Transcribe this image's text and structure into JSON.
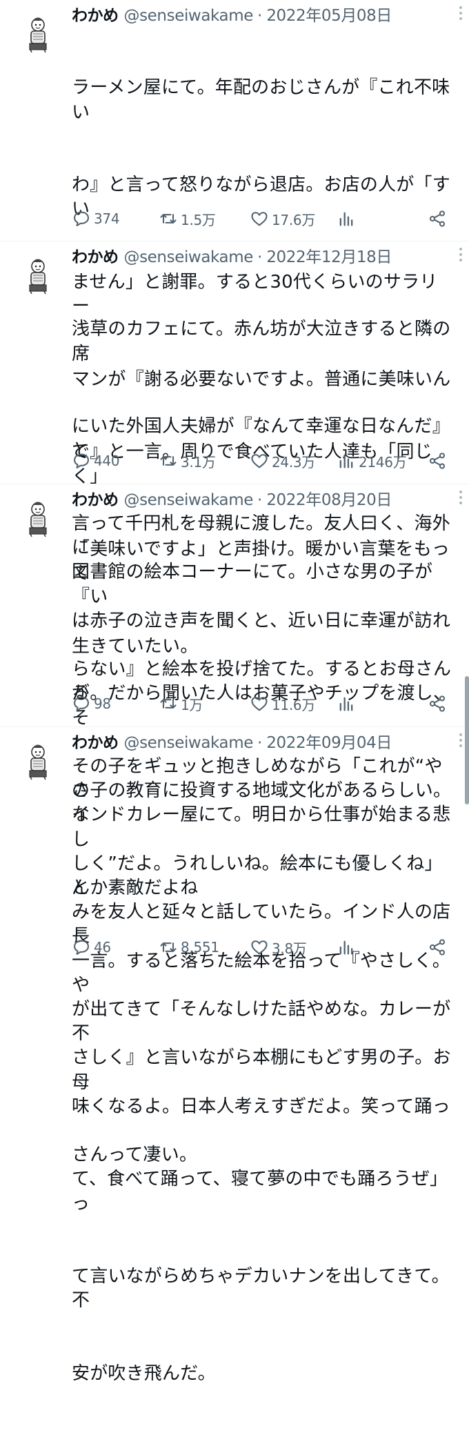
{
  "accent": "#536471",
  "tweets": [
    {
      "name": "わかめ",
      "handle": "@senseiwakame",
      "separator": "·",
      "date": "2022年05月08日",
      "text_lines": [
        "ラーメン屋にて。年配のおじさんが『これ不味い",
        "わ』と言って怒りながら退店。お店の人が「すい",
        "ません」と謝罪。すると30代くらいのサラリー",
        "マンが『謝る必要ないですよ。普通に美味いん",
        "で』と一言。周りで食べていた人達も「同じく」",
        "「美味いですよ」と声掛け。暖かい言葉をもって",
        "生きていたい。"
      ],
      "replies": "374",
      "retweets": "1.5万",
      "likes": "17.6万",
      "views": ""
    },
    {
      "name": "わかめ",
      "handle": "@senseiwakame",
      "separator": "·",
      "date": "2022年12月18日",
      "text_lines": [
        "浅草のカフェにて。赤ん坊が大泣きすると隣の席",
        "にいた外国人夫婦が『なんて幸運な日なんだ』と",
        "言って千円札を母親に渡した。友人曰く、海外に",
        "は赤子の泣き声を聞くと、近い日に幸運が訪れ",
        "る。だから聞いた人はお菓子やチップを渡し、そ",
        "の子の教育に投資する地域文化があるらしい。な",
        "んか素敵だよね"
      ],
      "replies": "440",
      "retweets": "3.1万",
      "likes": "24.3万",
      "views": "2146万"
    },
    {
      "name": "わかめ",
      "handle": "@senseiwakame",
      "separator": "·",
      "date": "2022年08月20日",
      "text_lines": [
        "図書館の絵本コーナーにて。小さな男の子が『い",
        "らない』と絵本を投げ捨てた。するとお母さんが",
        "その子をギュッと抱きしめながら「これが“やさ",
        "しく”だよ。うれしいね。絵本にも優しくね」と",
        "一言。すると落ちた絵本を拾って『やさしく。や",
        "さしく』と言いながら本棚にもどす男の子。お母",
        "さんって凄い。"
      ],
      "replies": "98",
      "retweets": "1万",
      "likes": "11.6万",
      "views": ""
    },
    {
      "name": "わかめ",
      "handle": "@senseiwakame",
      "separator": "·",
      "date": "2022年09月04日",
      "text_lines": [
        "インドカレー屋にて。明日から仕事が始まる悲し",
        "みを友人と延々と話していたら。インド人の店長",
        "が出てきて「そんなしけた話やめな。カレーが不",
        "味くなるよ。日本人考えすぎだよ。笑って踊っ",
        "て、食べて踊って、寝て夢の中でも踊ろうぜ」っ",
        "て言いながらめちゃデカいナンを出してきて。不",
        "安が吹き飛んだ。"
      ],
      "replies": "46",
      "retweets": "8,551",
      "likes": "3.8万",
      "views": ""
    }
  ]
}
